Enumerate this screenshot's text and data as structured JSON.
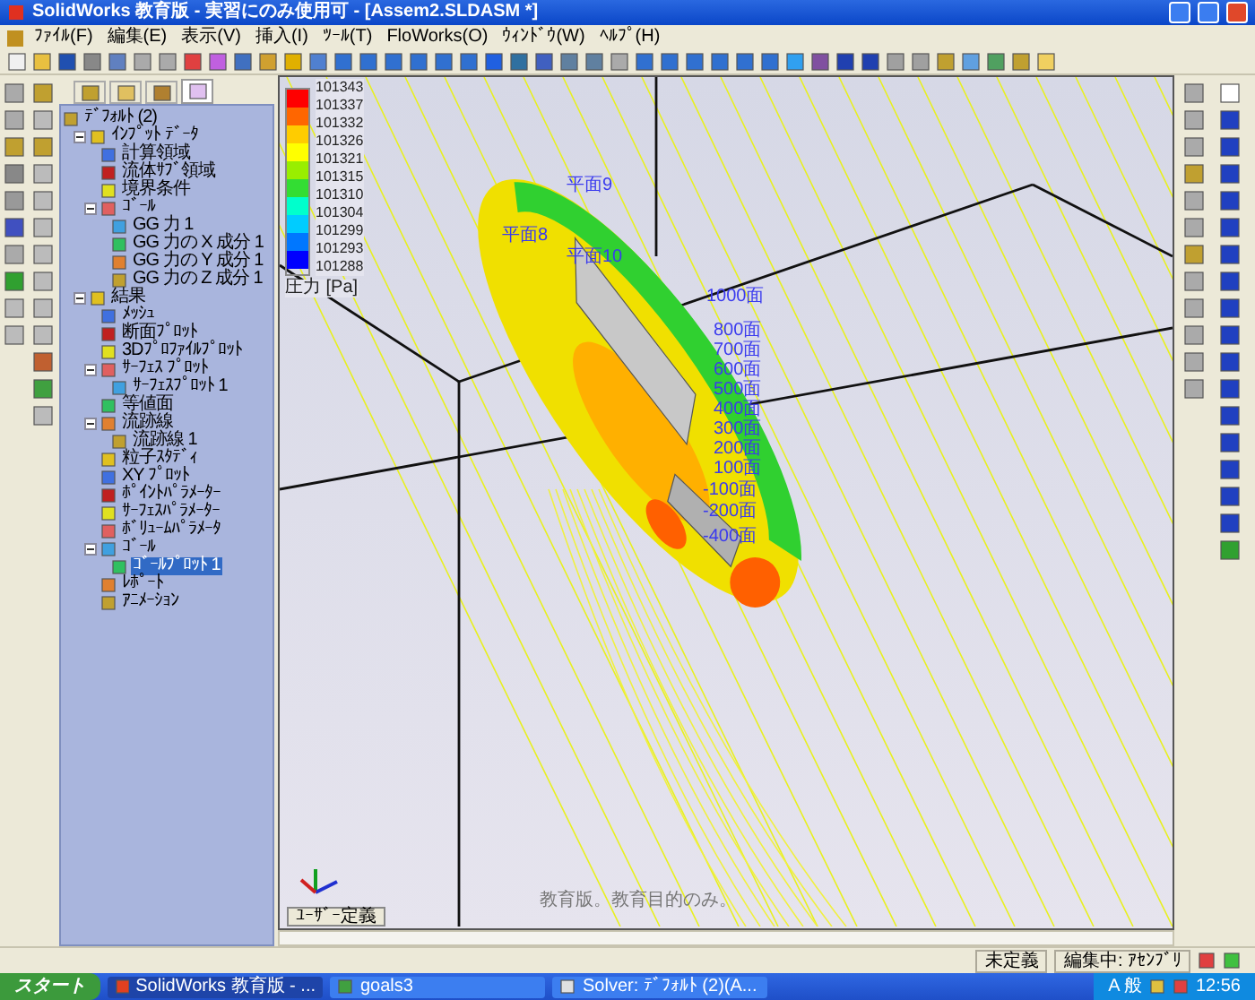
{
  "window": {
    "title": "SolidWorks 教育版 - 実習にのみ使用可 - [Assem2.SLDASM *]"
  },
  "menu": [
    "ﾌｧｲﾙ(F)",
    "編集(E)",
    "表示(V)",
    "挿入(I)",
    "ﾂｰﾙ(T)",
    "FloWorks(O)",
    "ｳｨﾝﾄﾞｳ(W)",
    "ﾍﾙﾌﾟ(H)"
  ],
  "tree": [
    {
      "label": "ﾃﾞﾌｫﾙﾄ (2)",
      "selected": false,
      "children": [
        {
          "label": "ｲﾝﾌﾟｯﾄ ﾃﾞｰﾀ",
          "selected": false,
          "expanded": true,
          "children": [
            {
              "label": "計算領域",
              "selected": false
            },
            {
              "label": "流体ｻﾌﾞ領域",
              "selected": false
            },
            {
              "label": "境界条件",
              "selected": false
            },
            {
              "label": "ｺﾞｰﾙ",
              "selected": false,
              "expanded": true,
              "children": [
                {
                  "label": "GG 力 1",
                  "selected": false
                },
                {
                  "label": "GG 力の X 成分 1",
                  "selected": false
                },
                {
                  "label": "GG 力の Y 成分 1",
                  "selected": false
                },
                {
                  "label": "GG 力の Z 成分 1",
                  "selected": false
                }
              ]
            }
          ]
        },
        {
          "label": "結果",
          "selected": false,
          "expanded": true,
          "children": [
            {
              "label": "ﾒｯｼｭ",
              "selected": false
            },
            {
              "label": "断面ﾌﾟﾛｯﾄ",
              "selected": false
            },
            {
              "label": "3Dﾌﾟﾛﾌｧｲﾙﾌﾟﾛｯﾄ",
              "selected": false
            },
            {
              "label": "ｻｰﾌｪｽ ﾌﾟﾛｯﾄ",
              "selected": false,
              "expanded": true,
              "children": [
                {
                  "label": "ｻｰﾌｪｽﾌﾟﾛｯﾄ 1",
                  "selected": false
                }
              ]
            },
            {
              "label": "等値面",
              "selected": false
            },
            {
              "label": "流跡線",
              "selected": false,
              "expanded": true,
              "children": [
                {
                  "label": "流跡線 1",
                  "selected": false
                }
              ]
            },
            {
              "label": "粒子ｽﾀﾃﾞｨ",
              "selected": false
            },
            {
              "label": "XY ﾌﾟﾛｯﾄ",
              "selected": false
            },
            {
              "label": "ﾎﾟｲﾝﾄﾊﾟﾗﾒｰﾀｰ",
              "selected": false
            },
            {
              "label": "ｻｰﾌｪｽﾊﾟﾗﾒｰﾀｰ",
              "selected": false
            },
            {
              "label": "ﾎﾞﾘｭｰﾑﾊﾟﾗﾒｰﾀ",
              "selected": false
            },
            {
              "label": "ｺﾞｰﾙ",
              "selected": false,
              "expanded": true,
              "children": [
                {
                  "label": "ｺﾞｰﾙﾌﾟﾛｯﾄ 1",
                  "selected": true
                }
              ]
            },
            {
              "label": "ﾚﾎﾟｰﾄ",
              "selected": false
            },
            {
              "label": "ｱﾆﾒｰｼｮﾝ",
              "selected": false
            }
          ]
        }
      ]
    }
  ],
  "legend": {
    "values": [
      "101343",
      "101337",
      "101332",
      "101326",
      "101321",
      "101315",
      "101310",
      "101304",
      "101299",
      "101293",
      "101288"
    ],
    "bands": [
      {
        "color": "#ff0000"
      },
      {
        "color": "#ff6600"
      },
      {
        "color": "#ffcc00"
      },
      {
        "color": "#ffff00"
      },
      {
        "color": "#99ee00"
      },
      {
        "color": "#33dd33"
      },
      {
        "color": "#00ffcc"
      },
      {
        "color": "#00ccff"
      },
      {
        "color": "#0077ff"
      },
      {
        "color": "#0000ff"
      }
    ],
    "title": "圧力 [Pa]"
  },
  "plane_labels": [
    "平面9",
    "平面8",
    "平面10",
    "1000面",
    "800面",
    "700面",
    "600面",
    "500面",
    "400面",
    "300面",
    "200面",
    "100面",
    "-100面",
    "-200面",
    "-400面"
  ],
  "viewport_notice": "教育版。教育目的のみ。",
  "view_selector": "ﾕｰｻﾞｰ定義",
  "status_bar": [
    "未定義",
    "編集中: ｱｾﾝﾌﾞﾘ"
  ],
  "taskbar": {
    "start": "スタート",
    "tasks": [
      {
        "label": "SolidWorks 教育版 - ...",
        "selected": true
      },
      {
        "label": "goals3",
        "selected": false
      },
      {
        "label": "Solver: ﾃﾞﾌｫﾙﾄ (2)(A...",
        "selected": false
      }
    ],
    "ime": "A 般",
    "clock": "12:56"
  }
}
